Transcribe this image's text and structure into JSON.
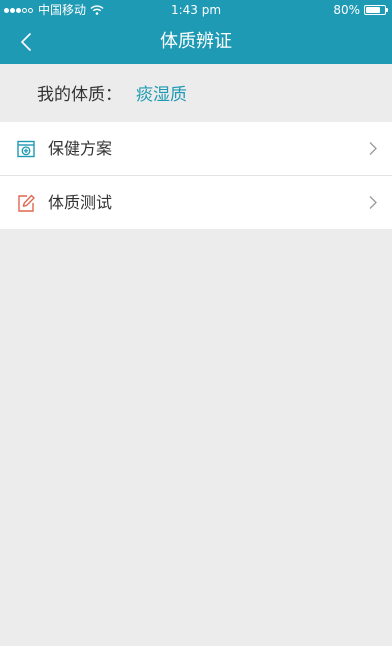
{
  "status_bar": {
    "carrier": "中国移动",
    "time": "1:43 pm",
    "battery": "80%",
    "battery_level": 0.8
  },
  "nav": {
    "title": "体质辨证"
  },
  "constitution": {
    "label": "我的体质：",
    "value": "痰湿质"
  },
  "menu": {
    "items": [
      {
        "label": "保健方案",
        "icon": "health-plan-icon"
      },
      {
        "label": "体质测试",
        "icon": "edit-icon"
      }
    ]
  },
  "colors": {
    "header": "#1f9ab4",
    "accent": "#1f9ab4",
    "health_icon": "#1f9ab4",
    "test_icon": "#e0664f",
    "background": "#ececec"
  }
}
